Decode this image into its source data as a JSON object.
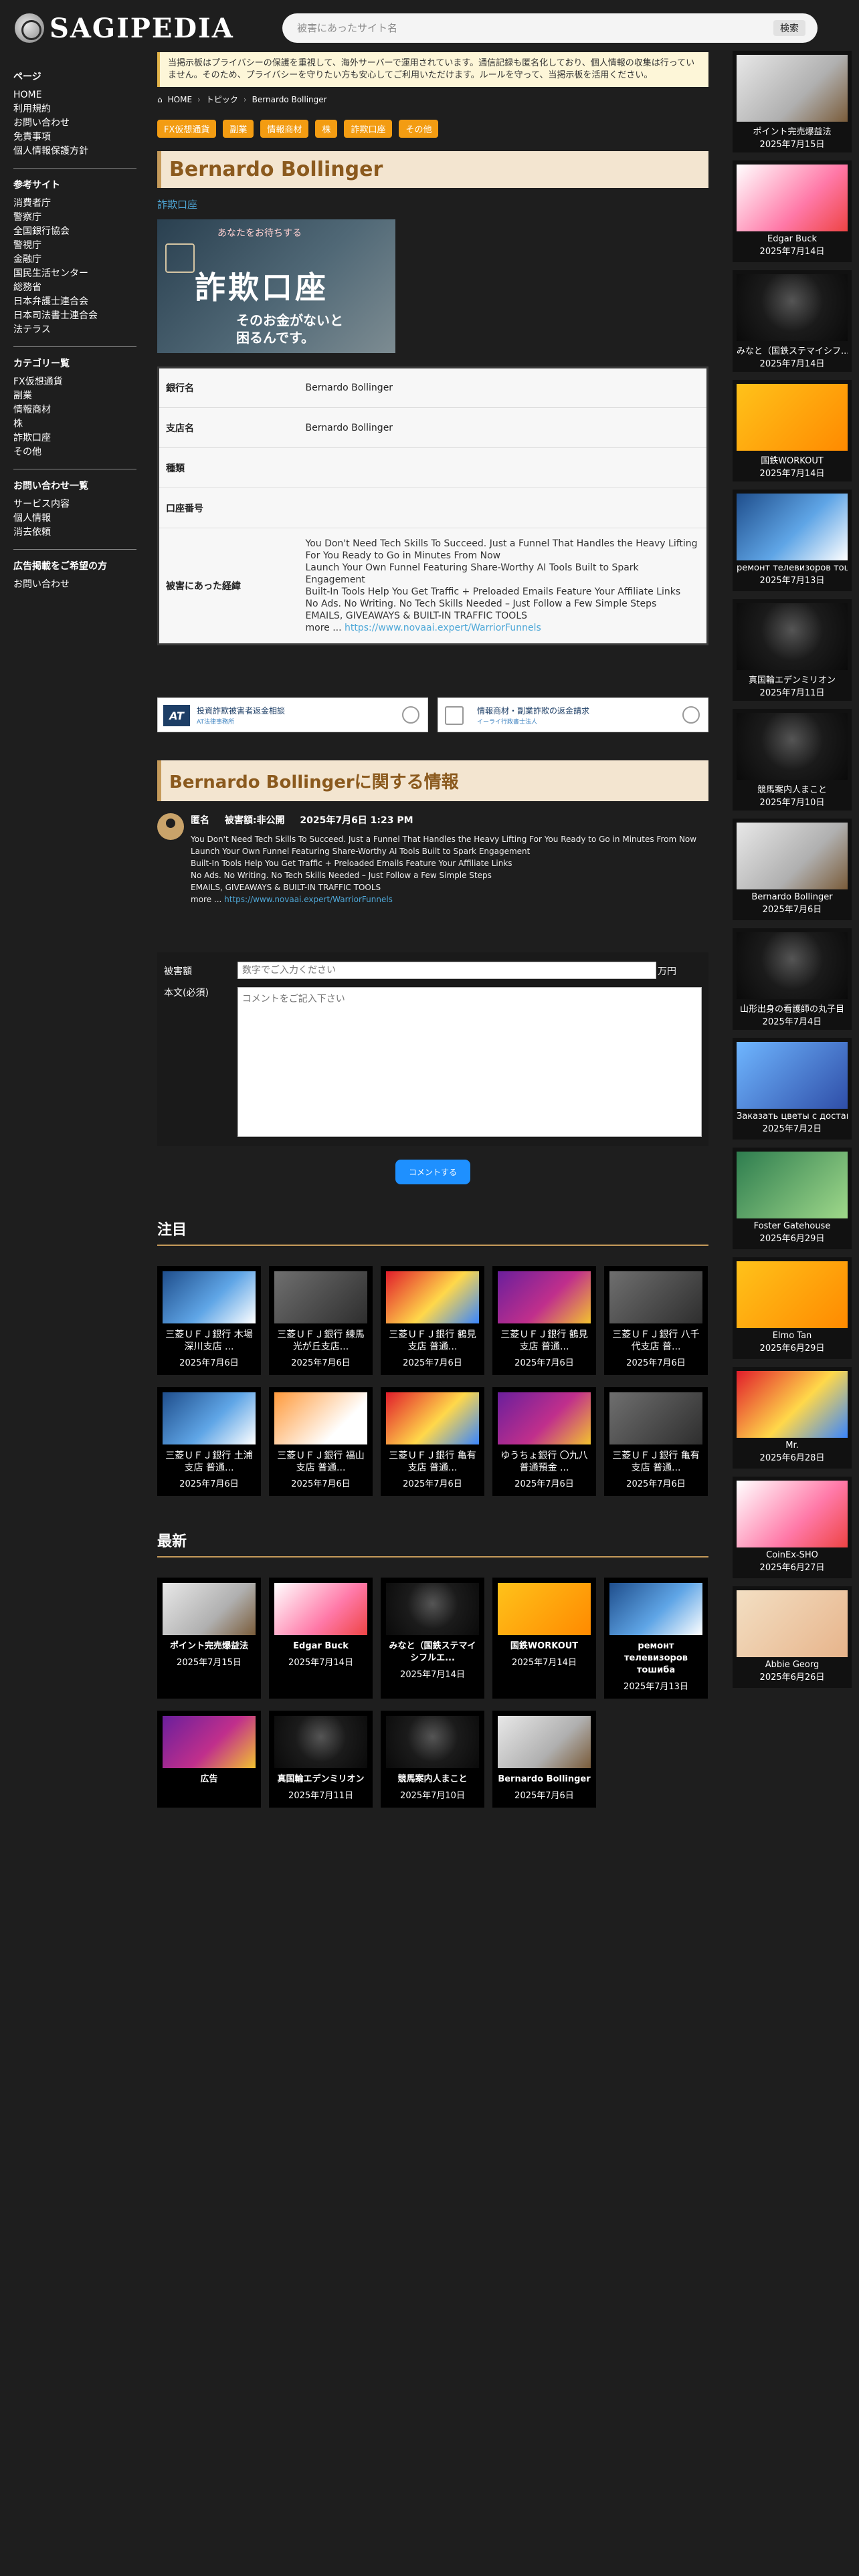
{
  "site": {
    "logo_text": "SAGIPEDIA"
  },
  "search": {
    "placeholder": "被害にあったサイト名",
    "button": "検索"
  },
  "leftnav": {
    "sections": [
      {
        "title": "ページ",
        "items": [
          "HOME",
          "利用規約",
          "お問い合わせ",
          "免責事項",
          "個人情報保護方針"
        ]
      },
      {
        "title": "参考サイト",
        "items": [
          "消費者庁",
          "警察庁",
          "全国銀行協会",
          "警視庁",
          "金融庁",
          "国民生活センター",
          "総務省",
          "日本弁護士連合会",
          "日本司法書士連合会",
          "法テラス"
        ]
      },
      {
        "title": "カテゴリー覧",
        "items": [
          "FX仮想通貨",
          "副業",
          "情報商材",
          "株",
          "詐欺口座",
          "その他"
        ]
      },
      {
        "title": "お問い合わせ一覧",
        "items": [
          "サービス内容",
          "個人情報",
          "消去依頼"
        ]
      },
      {
        "title": "広告掲載をご希望の方",
        "items": [
          "お問い合わせ"
        ]
      }
    ]
  },
  "notice": "当掲示板はプライバシーの保護を重視して、海外サーバーで運用されています。通信記録も匿名化しており、個人情報の収集は行っていません。そのため、プライバシーを守りたい方も安心してご利用いただけます。ルールを守って、当掲示板を活用ください。",
  "breadcrumb": {
    "home": "HOME",
    "topic": "トピック",
    "current": "Bernardo Bollinger"
  },
  "tags": [
    "FX仮想通貨",
    "副業",
    "情報商材",
    "株",
    "詐欺口座",
    "その他"
  ],
  "article": {
    "title": "Bernardo Bollinger",
    "category": "詐欺口座",
    "hero": {
      "top": "あなたをお待ちする",
      "title": "詐欺口座",
      "sub1": "そのお金がないと",
      "sub2": "困るんです。"
    },
    "table": {
      "bank_label": "銀行名",
      "bank_value": "Bernardo Bollinger",
      "branch_label": "支店名",
      "branch_value": "Bernardo Bollinger",
      "type_label": "種類",
      "type_value": "",
      "account_label": "口座番号",
      "account_value": "",
      "damage_label": "被害にあった経緯",
      "damage_lines": [
        "You Don't Need Tech Skills To Succeed. Just a Funnel That Handles the Heavy Lifting For You Ready to Go in Minutes From Now",
        "Launch Your Own Funnel Featuring Share-Worthy AI Tools Built to Spark Engagement",
        "Built-In Tools Help You Get Traffic + Preloaded Emails Feature Your Affiliate Links",
        "No Ads. No Writing. No Tech Skills Needed – Just Follow a Few Simple Steps",
        "EMAILS, GIVEAWAYS & BUILT-IN TRAFFIC TOOLS"
      ],
      "more_prefix": "more ... ",
      "more_link": "https://www.novaai.expert/WarriorFunnels"
    }
  },
  "banners": [
    {
      "logo": "AT",
      "line1": "投資詐欺被害者返金相談",
      "line2": "AT法律事務所"
    },
    {
      "logo": "",
      "line1": "情報商材・副業詐欺の返金請求",
      "line2": "イーライ行政書士法人"
    }
  ],
  "info_section": {
    "title": "Bernardo Bollingerに関する情報",
    "comment": {
      "author": "匿名",
      "amount": "被害額:非公開",
      "date": "2025年7月6日 1:23 PM",
      "lines": [
        "You Don't Need Tech Skills To Succeed. Just a Funnel That Handles the Heavy Lifting For You Ready to Go in Minutes From Now",
        "Launch Your Own Funnel Featuring Share-Worthy AI Tools Built to Spark Engagement",
        "Built-In Tools Help You Get Traffic + Preloaded Emails Feature Your Affiliate Links",
        "No Ads. No Writing. No Tech Skills Needed – Just Follow a Few Simple Steps",
        "EMAILS, GIVEAWAYS & BUILT-IN TRAFFIC TOOLS"
      ],
      "more_prefix": "more ... ",
      "more_link": "https://www.novaai.expert/WarriorFunnels"
    }
  },
  "form": {
    "amount_label": "被害額",
    "amount_placeholder": "数字でご入力ください",
    "amount_unit": "万円",
    "body_label": "本文(必須)",
    "body_placeholder": "コメントをご記入下さい",
    "submit": "コメントする"
  },
  "featured": {
    "title": "注目",
    "cards": [
      {
        "title": "三菱ＵＦＪ銀行 木場深川支店 ...",
        "date": "2025年7月6日",
        "tone": "t-blue"
      },
      {
        "title": "三菱ＵＦＪ銀行 練馬光が丘支店...",
        "date": "2025年7月6日",
        "tone": "t-gray"
      },
      {
        "title": "三菱ＵＦＪ銀行 鶴見支店 普通...",
        "date": "2025年7月6日",
        "tone": "t-red"
      },
      {
        "title": "三菱ＵＦＪ銀行 鶴見支店 普通...",
        "date": "2025年7月6日",
        "tone": "t-purple"
      },
      {
        "title": "三菱ＵＦＪ銀行 八千代支店 普...",
        "date": "2025年7月6日",
        "tone": "t-gray"
      },
      {
        "title": "三菱ＵＦＪ銀行 土浦支店 普通...",
        "date": "2025年7月6日",
        "tone": "t-blue"
      },
      {
        "title": "三菱ＵＦＪ銀行 福山支店 普通...",
        "date": "2025年7月6日",
        "tone": "t-orange"
      },
      {
        "title": "三菱ＵＦＪ銀行 亀有支店 普通...",
        "date": "2025年7月6日",
        "tone": "t-red"
      },
      {
        "title": "ゆうちょ銀行 〇九八 普通預金 ...",
        "date": "2025年7月6日",
        "tone": "t-purple"
      },
      {
        "title": "三菱ＵＦＪ銀行 亀有支店 普通...",
        "date": "2025年7月6日",
        "tone": "t-gray"
      }
    ]
  },
  "latest": {
    "title": "最新",
    "cards": [
      {
        "title": "ポイント完売爆益法",
        "date": "2025年7月15日",
        "tone": "t-white"
      },
      {
        "title": "Edgar Buck",
        "date": "2025年7月14日",
        "tone": "t-pink"
      },
      {
        "title": "みなと（国鉄ステマイシフルエ...",
        "date": "2025年7月14日",
        "tone": "t-dark"
      },
      {
        "title": "国鉄WORKOUT",
        "date": "2025年7月14日",
        "tone": "t-yellow"
      },
      {
        "title": "ремонт телевизоров тошиба",
        "date": "2025年7月13日",
        "tone": "t-blue"
      },
      {
        "title": "広告",
        "date": "",
        "tone": "t-purple"
      },
      {
        "title": "真国輪エデンミリオン",
        "date": "2025年7月11日",
        "tone": "t-dark"
      },
      {
        "title": "競馬案内人まこと",
        "date": "2025年7月10日",
        "tone": "t-dark"
      },
      {
        "title": "Bernardo Bollinger",
        "date": "2025年7月6日",
        "tone": "t-white"
      }
    ]
  },
  "rightbar": [
    {
      "title": "ポイント完売爆益法",
      "date": "2025年7月15日",
      "tone": "t-white"
    },
    {
      "title": "Edgar Buck",
      "date": "2025年7月14日",
      "tone": "t-pink"
    },
    {
      "title": "みなと（国鉄ステマイシフ...",
      "date": "2025年7月14日",
      "tone": "t-dark"
    },
    {
      "title": "国鉄WORKOUT",
      "date": "2025年7月14日",
      "tone": "t-yellow"
    },
    {
      "title": "ремонт телевизоров тошиба",
      "date": "2025年7月13日",
      "tone": "t-blue"
    },
    {
      "title": "真国輪エデンミリオン",
      "date": "2025年7月11日",
      "tone": "t-dark"
    },
    {
      "title": "競馬案内人まこと",
      "date": "2025年7月10日",
      "tone": "t-dark"
    },
    {
      "title": "Bernardo Bollinger",
      "date": "2025年7月6日",
      "tone": "t-white"
    },
    {
      "title": "山形出身の看護師の丸子目",
      "date": "2025年7月4日",
      "tone": "t-dark"
    },
    {
      "title": "Заказать цветы с доставкой",
      "date": "2025年7月2日",
      "tone": "t-sky"
    },
    {
      "title": "Foster Gatehouse",
      "date": "2025年6月29日",
      "tone": "t-green"
    },
    {
      "title": "Elmo Tan",
      "date": "2025年6月29日",
      "tone": "t-yellow"
    },
    {
      "title": "Mr.",
      "date": "2025年6月28日",
      "tone": "t-red"
    },
    {
      "title": "CoinEx-SHO",
      "date": "2025年6月27日",
      "tone": "t-pink"
    },
    {
      "title": "Abbie Georg",
      "date": "2025年6月26日",
      "tone": "t-cream"
    }
  ]
}
